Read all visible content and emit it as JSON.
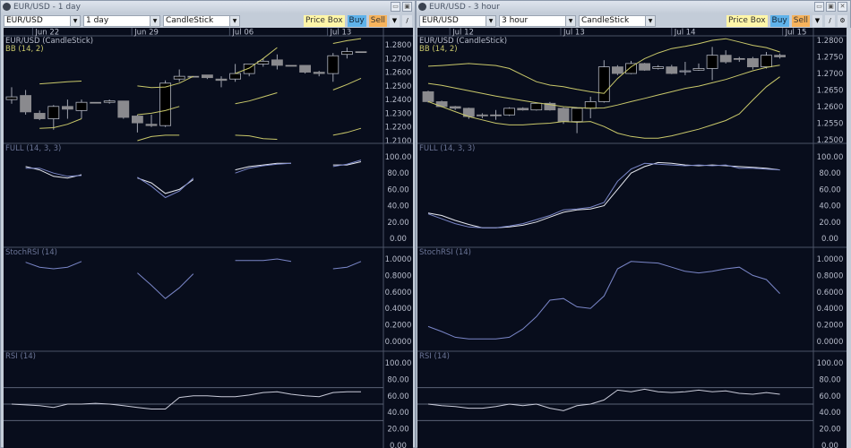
{
  "windows": [
    {
      "title": "EUR/USD - 1 day",
      "symbol": "EUR/USD",
      "interval": "1 day",
      "chart_type": "CandleStick",
      "buttons": {
        "price_box": "Price Box",
        "buy": "Buy",
        "sell": "Sell"
      },
      "dates": [
        {
          "label": "Jun 22",
          "at": 1.5
        },
        {
          "label": "Jun 29",
          "at": 8.6
        },
        {
          "label": "Jul 06",
          "at": 15.6
        },
        {
          "label": "Jul 13",
          "at": 22.6
        }
      ],
      "panels": [
        {
          "label": "EUR/USD (CandleStick)",
          "sublabel": "BB (14, 2)",
          "ticks": [
            "1.2800",
            "1.2700",
            "1.2600",
            "1.2500",
            "1.2400",
            "1.2300",
            "1.2200",
            "1.2100"
          ],
          "candles": [
            [
              1.24,
              1.249,
              1.237,
              1.242
            ],
            [
              1.243,
              1.247,
              1.229,
              1.231
            ],
            [
              1.23,
              1.232,
              1.225,
              1.226
            ],
            [
              1.226,
              1.236,
              1.218,
              1.235
            ],
            [
              1.235,
              1.24,
              1.226,
              1.233
            ],
            [
              1.232,
              1.24,
              1.226,
              1.238
            ],
            [
              1.238,
              1.238,
              1.238,
              1.238
            ],
            [
              1.238,
              1.24,
              1.237,
              1.239
            ],
            [
              1.239,
              1.239,
              1.226,
              1.227
            ],
            [
              1.228,
              1.229,
              1.216,
              1.223
            ],
            [
              1.222,
              1.229,
              1.22,
              1.221
            ],
            [
              1.221,
              1.254,
              1.22,
              1.252
            ],
            [
              1.255,
              1.262,
              1.253,
              1.257
            ],
            [
              1.257,
              1.257,
              1.257,
              1.257
            ],
            [
              1.258,
              1.258,
              1.255,
              1.256
            ],
            [
              1.255,
              1.257,
              1.249,
              1.254
            ],
            [
              1.255,
              1.266,
              1.253,
              1.259
            ],
            [
              1.259,
              1.266,
              1.257,
              1.266
            ],
            [
              1.266,
              1.27,
              1.264,
              1.268
            ],
            [
              1.269,
              1.273,
              1.262,
              1.265
            ],
            [
              1.265,
              1.265,
              1.265,
              1.265
            ],
            [
              1.265,
              1.265,
              1.259,
              1.26
            ],
            [
              1.26,
              1.261,
              1.257,
              1.259
            ],
            [
              1.259,
              1.274,
              1.253,
              1.272
            ],
            [
              1.273,
              1.278,
              1.27,
              1.275
            ],
            [
              1.275,
              1.275,
              1.275,
              1.275
            ]
          ],
          "lines": [
            {
              "color": "#c9c86a",
              "values": [
                null,
                null,
                null,
                null,
                null,
                null,
                null,
                null,
                null,
                1.25,
                1.2487,
                1.2492,
                1.252,
                1.257,
                null,
                null,
                1.259,
                1.263,
                1.27,
                1.278,
                null,
                null,
                null,
                1.281,
                1.283,
                1.2845
              ]
            },
            {
              "color": "#c9c86a",
              "values": [
                null,
                null,
                1.2515,
                1.2522,
                1.253,
                1.2535,
                null,
                null,
                null,
                1.229,
                1.23,
                1.232,
                1.235,
                null,
                null,
                null,
                1.237,
                1.239,
                1.242,
                1.245,
                null,
                null,
                null,
                1.247,
                1.251,
                1.2555
              ]
            },
            {
              "color": "#c9c86a",
              "values": [
                null,
                null,
                1.219,
                1.2195,
                1.222,
                1.226,
                null,
                null,
                null,
                1.21,
                1.213,
                1.214,
                1.214,
                null,
                null,
                null,
                1.214,
                1.2135,
                1.2115,
                1.211,
                null,
                null,
                null,
                1.214,
                1.216,
                1.219
              ]
            }
          ]
        },
        {
          "label": "FULL (14, 3, 3)",
          "ticks": [
            "100.00",
            "80.00",
            "60.00",
            "40.00",
            "20.00",
            "0.00"
          ],
          "lines": [
            {
              "color": "#e6e8f0",
              "values": [
                null,
                88,
                84,
                76,
                74,
                78,
                null,
                null,
                null,
                74,
                68,
                55,
                60,
                72,
                null,
                null,
                84,
                88,
                90,
                92,
                92,
                null,
                null,
                90,
                90,
                94
              ]
            },
            {
              "color": "#7a86c8",
              "values": [
                null,
                86,
                86,
                80,
                76,
                77,
                null,
                null,
                null,
                75,
                64,
                50,
                58,
                74,
                null,
                null,
                80,
                86,
                89,
                91,
                92,
                null,
                null,
                88,
                91,
                96
              ]
            }
          ]
        },
        {
          "label": "StochRSI (14)",
          "ticks": [
            "1.0000",
            "0.8000",
            "0.6000",
            "0.4000",
            "0.2000",
            "0.0000"
          ],
          "lines": [
            {
              "color": "#7a86c8",
              "values": [
                null,
                0.96,
                0.9,
                0.88,
                0.9,
                0.97,
                null,
                null,
                null,
                0.83,
                0.68,
                0.52,
                0.65,
                0.82,
                null,
                null,
                0.98,
                0.98,
                0.98,
                1.0,
                0.97,
                null,
                null,
                0.88,
                0.9,
                0.97
              ]
            }
          ]
        },
        {
          "label": "RSI (14)",
          "ticks": [
            "100.00",
            "80.00",
            "60.00",
            "40.00",
            "20.00",
            "0.00"
          ],
          "guides": [
            70,
            50,
            30
          ],
          "lines": [
            {
              "color": "#c8cad8",
              "values": [
                50,
                49,
                48,
                46,
                50,
                50,
                51,
                50,
                48,
                46,
                44,
                44,
                58,
                60,
                60,
                59,
                59,
                61,
                64,
                65,
                62,
                60,
                59,
                64,
                65,
                65
              ]
            }
          ]
        }
      ]
    },
    {
      "title": "EUR/USD - 3 hour",
      "symbol": "EUR/USD",
      "interval": "3 hour",
      "chart_type": "CandleStick",
      "buttons": {
        "price_box": "Price Box",
        "buy": "Buy",
        "sell": "Sell"
      },
      "dates": [
        {
          "label": "Jul 12",
          "at": 1.6
        },
        {
          "label": "Jul 13",
          "at": 9.8
        },
        {
          "label": "Jul 14",
          "at": 18.0
        },
        {
          "label": "Jul 15",
          "at": 26.2
        }
      ],
      "panels": [
        {
          "label": "EUR/USD (CandleStick)",
          "sublabel": "BB (14, 2)",
          "ticks": [
            "1.2800",
            "1.2750",
            "1.2700",
            "1.2650",
            "1.2600",
            "1.2550",
            "1.2500"
          ],
          "candles": [
            [
              1.2645,
              1.2648,
              1.2612,
              1.2615
            ],
            [
              1.2615,
              1.2618,
              1.2598,
              1.26
            ],
            [
              1.26,
              1.2602,
              1.259,
              1.2595
            ],
            [
              1.2595,
              1.2597,
              1.2563,
              1.257
            ],
            [
              1.2575,
              1.258,
              1.2565,
              1.2572
            ],
            [
              1.2575,
              1.259,
              1.256,
              1.2575
            ],
            [
              1.2575,
              1.2598,
              1.2572,
              1.2595
            ],
            [
              1.2595,
              1.2598,
              1.2588,
              1.259
            ],
            [
              1.259,
              1.2612,
              1.2588,
              1.261
            ],
            [
              1.261,
              1.2614,
              1.2588,
              1.259
            ],
            [
              1.2595,
              1.2598,
              1.2548,
              1.2555
            ],
            [
              1.2555,
              1.2598,
              1.252,
              1.2595
            ],
            [
              1.2595,
              1.263,
              1.2565,
              1.2615
            ],
            [
              1.2615,
              1.274,
              1.2612,
              1.272
            ],
            [
              1.272,
              1.2725,
              1.2695,
              1.27
            ],
            [
              1.27,
              1.2738,
              1.2698,
              1.273
            ],
            [
              1.273,
              1.2732,
              1.2708,
              1.271
            ],
            [
              1.2715,
              1.2725,
              1.2712,
              1.272
            ],
            [
              1.272,
              1.2726,
              1.2698,
              1.27
            ],
            [
              1.2705,
              1.2735,
              1.2695,
              1.2708
            ],
            [
              1.271,
              1.273,
              1.2708,
              1.2715
            ],
            [
              1.2715,
              1.278,
              1.268,
              1.2755
            ],
            [
              1.2755,
              1.277,
              1.273,
              1.2735
            ],
            [
              1.2745,
              1.275,
              1.2735,
              1.2745
            ],
            [
              1.2745,
              1.275,
              1.2712,
              1.272
            ],
            [
              1.272,
              1.2765,
              1.2715,
              1.2755
            ],
            [
              1.2755,
              1.276,
              1.2745,
              1.275
            ]
          ],
          "lines": [
            {
              "color": "#c9c86a",
              "values": [
                1.2722,
                1.2724,
                1.2727,
                1.273,
                1.2727,
                1.2724,
                1.2715,
                1.2695,
                1.2675,
                1.2665,
                1.266,
                1.2652,
                1.2645,
                1.264,
                1.2685,
                1.272,
                1.2745,
                1.2762,
                1.2775,
                1.2782,
                1.279,
                1.28,
                1.2805,
                1.2795,
                1.2785,
                1.2778,
                1.2765
              ]
            },
            {
              "color": "#c9c86a",
              "values": [
                1.267,
                1.2664,
                1.2656,
                1.2648,
                1.264,
                1.2632,
                1.2625,
                1.2618,
                1.2612,
                1.2606,
                1.26,
                1.2597,
                1.2595,
                1.2596,
                1.2605,
                1.2615,
                1.2625,
                1.2635,
                1.2645,
                1.2655,
                1.2662,
                1.2672,
                1.2682,
                1.2695,
                1.2708,
                1.2718,
                1.2725
              ]
            },
            {
              "color": "#c9c86a",
              "values": [
                1.2615,
                1.26,
                1.2585,
                1.257,
                1.256,
                1.255,
                1.2545,
                1.2545,
                1.2548,
                1.255,
                1.2555,
                1.2553,
                1.2555,
                1.254,
                1.252,
                1.251,
                1.2505,
                1.2505,
                1.2512,
                1.2522,
                1.2532,
                1.2545,
                1.2558,
                1.2578,
                1.262,
                1.266,
                1.269
              ]
            }
          ]
        },
        {
          "label": "FULL (14, 3, 3)",
          "ticks": [
            "100.00",
            "80.00",
            "60.00",
            "40.00",
            "20.00",
            "0.00"
          ],
          "lines": [
            {
              "color": "#e6e8f0",
              "values": [
                31,
                28,
                22,
                17,
                13,
                13,
                14,
                16,
                20,
                26,
                32,
                35,
                36,
                40,
                60,
                80,
                88,
                93,
                92,
                90,
                89,
                90,
                89,
                88,
                87,
                86,
                84
              ]
            },
            {
              "color": "#7a86c8",
              "values": [
                30,
                24,
                18,
                14,
                13,
                13,
                15,
                18,
                23,
                28,
                35,
                36,
                38,
                44,
                70,
                85,
                92,
                91,
                90,
                89,
                90,
                89,
                90,
                86,
                86,
                85,
                84
              ]
            }
          ]
        },
        {
          "label": "StochRSI (14)",
          "ticks": [
            "1.0000",
            "0.8000",
            "0.6000",
            "0.4000",
            "0.2000",
            "0.0000"
          ],
          "lines": [
            {
              "color": "#7a86c8",
              "values": [
                0.18,
                0.12,
                0.05,
                0.03,
                0.03,
                0.03,
                0.05,
                0.15,
                0.3,
                0.5,
                0.52,
                0.42,
                0.4,
                0.55,
                0.88,
                0.97,
                0.96,
                0.95,
                0.9,
                0.85,
                0.83,
                0.85,
                0.88,
                0.9,
                0.8,
                0.75,
                0.58
              ]
            }
          ]
        },
        {
          "label": "RSI (14)",
          "ticks": [
            "100.00",
            "80.00",
            "60.00",
            "40.00",
            "20.00",
            "0.00"
          ],
          "guides": [
            70,
            50,
            30
          ],
          "lines": [
            {
              "color": "#c8cad8",
              "values": [
                50,
                48,
                47,
                45,
                45,
                47,
                50,
                48,
                50,
                45,
                42,
                48,
                50,
                55,
                67,
                65,
                68,
                65,
                64,
                65,
                67,
                65,
                66,
                63,
                62,
                64,
                62
              ]
            }
          ]
        }
      ]
    }
  ]
}
